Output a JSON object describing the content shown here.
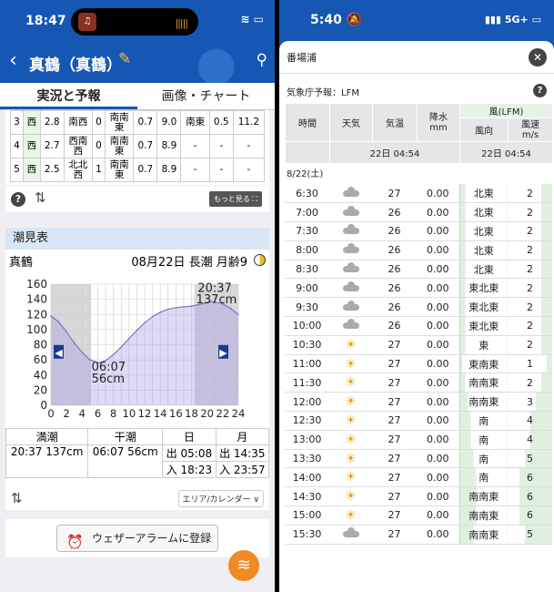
{
  "left": {
    "status": {
      "time": "18:47"
    },
    "nav": {
      "title": "真鶴（真鶴）"
    },
    "tabs": [
      "実況と予報",
      "画像・チャート"
    ],
    "weather_rows": [
      [
        "3",
        "西",
        "2.8",
        "南西",
        "0",
        "南南\n東",
        "0.7",
        "9.0",
        "南東",
        "0.5",
        "11.2"
      ],
      [
        "4",
        "西",
        "2.7",
        "西南\n西",
        "0",
        "南南\n東",
        "0.7",
        "8.9",
        "-",
        "-",
        "-"
      ],
      [
        "5",
        "西",
        "2.5",
        "北北\n西",
        "1",
        "南南\n東",
        "0.7",
        "8.9",
        "-",
        "-",
        "-"
      ]
    ],
    "more_label": "もっと見る ⛶",
    "tide": {
      "header": "潮見表",
      "place": "真鶴",
      "date_info": "08月22日 長潮 月齢9",
      "high_label_time": "20:37",
      "high_label_height": "137cm",
      "low_label_time": "06:07",
      "low_label_height": "56cm",
      "table_headers": [
        "満潮",
        "干潮",
        "日",
        "月"
      ],
      "high": "20:37 137cm",
      "low": "06:07 56cm",
      "sunrise": "出 05:08",
      "sunset": "入 18:23",
      "moonrise": "出 14:35",
      "moonset": "入 23:57",
      "area_label": "エリア/カレンダー ∨"
    },
    "alarm_label": "ウェザーアラームに登録"
  },
  "chart_data": {
    "type": "area",
    "title": "",
    "xlabel": "",
    "ylabel": "",
    "x_ticks": [
      0,
      2,
      4,
      6,
      8,
      10,
      12,
      14,
      16,
      18,
      20,
      22,
      24
    ],
    "y_ticks": [
      0,
      20,
      40,
      60,
      80,
      100,
      120,
      140,
      160
    ],
    "xlim": [
      0,
      24
    ],
    "ylim": [
      0,
      160
    ],
    "grid": true,
    "x": [
      0,
      1,
      2,
      3,
      4,
      5,
      6.1,
      7,
      8,
      9,
      10,
      11,
      12,
      13,
      14,
      15,
      16,
      17,
      18,
      19,
      20.6,
      22,
      23,
      24
    ],
    "values": [
      118,
      110,
      97,
      82,
      70,
      60,
      56,
      59,
      67,
      77,
      88,
      99,
      109,
      117,
      123,
      127,
      129,
      130,
      131,
      133,
      137,
      134,
      128,
      120
    ]
  },
  "right": {
    "status": {
      "time": "5:40",
      "signal": "5G+"
    },
    "sheet_title": "番場浦",
    "forecast_label": "気象庁予報：LFM",
    "headers": {
      "time": "時間",
      "weather": "天気",
      "temp": "気温",
      "precip": "降水\nmm",
      "wind": "風(LFM)",
      "dir": "風向",
      "speed": "風速\nm/s"
    },
    "issued_left": "22日 04:54",
    "issued_right": "22日 04:54",
    "date_label": "8/22(土)",
    "rows": [
      {
        "time": "6:30",
        "w": "cloud",
        "temp": "27",
        "precip": "0.00",
        "dir": "北東",
        "speed": "2"
      },
      {
        "time": "7:00",
        "w": "cloud",
        "temp": "26",
        "precip": "0.00",
        "dir": "北東",
        "speed": "2"
      },
      {
        "time": "7:30",
        "w": "cloud",
        "temp": "26",
        "precip": "0.00",
        "dir": "北東",
        "speed": "2"
      },
      {
        "time": "8:00",
        "w": "cloud",
        "temp": "26",
        "precip": "0.00",
        "dir": "北東",
        "speed": "2"
      },
      {
        "time": "8:30",
        "w": "cloud",
        "temp": "26",
        "precip": "0.00",
        "dir": "北東",
        "speed": "2"
      },
      {
        "time": "9:00",
        "w": "cloud",
        "temp": "26",
        "precip": "0.00",
        "dir": "東北東",
        "speed": "2"
      },
      {
        "time": "9:30",
        "w": "cloud",
        "temp": "26",
        "precip": "0.00",
        "dir": "東北東",
        "speed": "2"
      },
      {
        "time": "10:00",
        "w": "cloud",
        "temp": "26",
        "precip": "0.00",
        "dir": "東北東",
        "speed": "2"
      },
      {
        "time": "10:30",
        "w": "sun",
        "temp": "27",
        "precip": "0.00",
        "dir": "東",
        "speed": "2"
      },
      {
        "time": "11:00",
        "w": "sun",
        "temp": "27",
        "precip": "0.00",
        "dir": "東南東",
        "speed": "1"
      },
      {
        "time": "11:30",
        "w": "sun",
        "temp": "27",
        "precip": "0.00",
        "dir": "南南東",
        "speed": "2"
      },
      {
        "time": "12:00",
        "w": "sun",
        "temp": "27",
        "precip": "0.00",
        "dir": "南南東",
        "speed": "3"
      },
      {
        "time": "12:30",
        "w": "sun",
        "temp": "27",
        "precip": "0.00",
        "dir": "南",
        "speed": "4"
      },
      {
        "time": "13:00",
        "w": "sun",
        "temp": "27",
        "precip": "0.00",
        "dir": "南",
        "speed": "4"
      },
      {
        "time": "13:30",
        "w": "sun",
        "temp": "27",
        "precip": "0.00",
        "dir": "南",
        "speed": "5"
      },
      {
        "time": "14:00",
        "w": "sun",
        "temp": "27",
        "precip": "0.00",
        "dir": "南",
        "speed": "6"
      },
      {
        "time": "14:30",
        "w": "sun",
        "temp": "27",
        "precip": "0.00",
        "dir": "南南東",
        "speed": "6"
      },
      {
        "time": "15:00",
        "w": "sun",
        "temp": "27",
        "precip": "0.00",
        "dir": "南南東",
        "speed": "6"
      },
      {
        "time": "15:30",
        "w": "cloud",
        "temp": "27",
        "precip": "0.00",
        "dir": "南南東",
        "speed": "5"
      }
    ]
  },
  "colors": {
    "brand": "#1557b3",
    "accent": "#f08a24",
    "wind_bar": "#dff0df"
  }
}
